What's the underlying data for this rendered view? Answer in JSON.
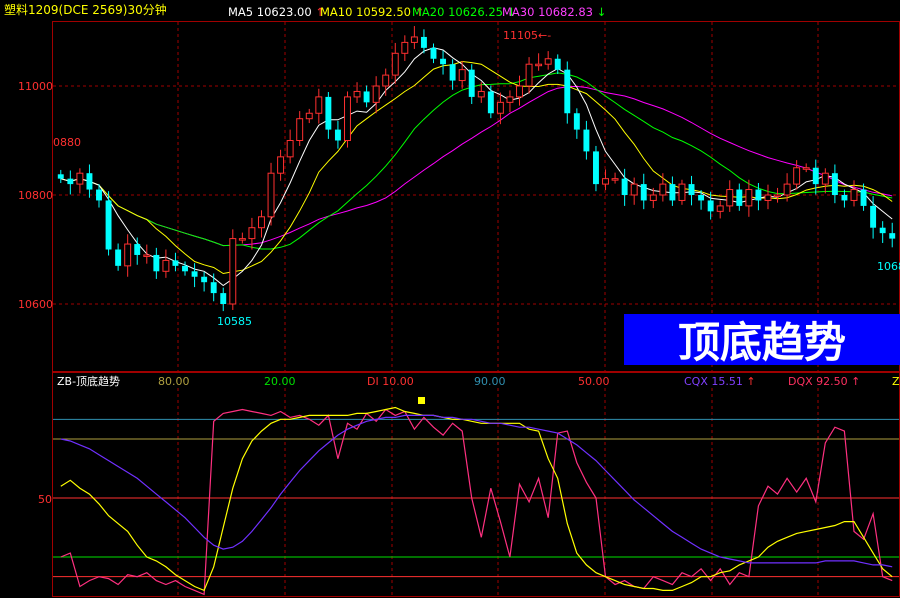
{
  "header": {
    "instrument": "塑料1209(DCE 2569)30分钟",
    "ma": [
      {
        "label": "MA5",
        "value": "10623.00",
        "arrow": "↑",
        "color": "#ffffff"
      },
      {
        "label": "MA10",
        "value": "10592.50",
        "arrow": "↑",
        "color": "#ffff00"
      },
      {
        "label": "MA20",
        "value": "10626.25",
        "arrow": "↓",
        "color": "#00ff00"
      },
      {
        "label": "MA30",
        "value": "10682.83",
        "arrow": "↓",
        "color": "#ff00ff"
      }
    ]
  },
  "price_axis": {
    "ticks": [
      "11000",
      "10800",
      "10600"
    ]
  },
  "annotations": {
    "left_high": "0880",
    "peak": "11105",
    "low": "10585",
    "right_edge": "1068"
  },
  "banner": {
    "text": "顶底趋势"
  },
  "indicator": {
    "name": "ZB-顶底趋势",
    "params": [
      {
        "label": "",
        "value": "80.00",
        "color": "#b0a040"
      },
      {
        "label": "",
        "value": "20.00",
        "color": "#00e000"
      },
      {
        "label": "DI",
        "value": "10.00",
        "color": "#ff3030"
      },
      {
        "label": "",
        "value": "90.00",
        "color": "#3090b0"
      },
      {
        "label": "",
        "value": "50.00",
        "color": "#ff3030"
      },
      {
        "label": "CQX",
        "value": "15.51",
        "arrow": "↑",
        "color": "#8040ff"
      },
      {
        "label": "DQX",
        "value": "92.50",
        "arrow": "↑",
        "color": "#ff3060"
      },
      {
        "label": "Z",
        "value": "",
        "color": "#ffff00"
      }
    ],
    "axis_label": "50"
  },
  "colors": {
    "up": "#ff3030",
    "down": "#00ffff",
    "grid": "#a00000",
    "ma5": "#ffffff",
    "ma10": "#ffff00",
    "ma20": "#00ff00",
    "ma30": "#ff00ff",
    "banner_bg": "#0000ff"
  },
  "chart_data": [
    {
      "type": "candlestick",
      "title": "塑料1209(DCE 2569)30分钟",
      "ylim": [
        10500,
        11120
      ],
      "close": [
        10830,
        10820,
        10840,
        10810,
        10790,
        10700,
        10670,
        10710,
        10690,
        10690,
        10660,
        10680,
        10670,
        10660,
        10650,
        10640,
        10620,
        10600,
        10720,
        10720,
        10740,
        10760,
        10840,
        10870,
        10900,
        10940,
        10950,
        10980,
        10920,
        10900,
        10980,
        10990,
        10970,
        11000,
        11020,
        11060,
        11080,
        11090,
        11070,
        11050,
        11040,
        11010,
        11030,
        10980,
        10990,
        10950,
        10970,
        10980,
        11000,
        11040,
        11040,
        11050,
        11030,
        10950,
        10920,
        10880,
        10820,
        10830,
        10830,
        10800,
        10820,
        10790,
        10800,
        10820,
        10790,
        10820,
        10800,
        10790,
        10770,
        10780,
        10810,
        10780,
        10810,
        10790,
        10800,
        10800,
        10820,
        10850,
        10850,
        10820,
        10840,
        10800,
        10790,
        10810,
        10780,
        10740,
        10730,
        10720
      ]
    },
    {
      "type": "line",
      "title": "ZB-顶底趋势",
      "ylim": [
        0,
        100
      ],
      "series": [
        {
          "name": "DI",
          "values": [
            20,
            22,
            5,
            8,
            10,
            9,
            6,
            11,
            10,
            12,
            8,
            6,
            8,
            5,
            3,
            1,
            89,
            93,
            94,
            95,
            94,
            93,
            92,
            94,
            91,
            92,
            90,
            87,
            92,
            70,
            88,
            85,
            93,
            89,
            95,
            92,
            94,
            85,
            91,
            86,
            82,
            88,
            84,
            50,
            30,
            55,
            38,
            20,
            57,
            48,
            60,
            40,
            83,
            84,
            68,
            58,
            50,
            10,
            6,
            8,
            5,
            4,
            10,
            8,
            6,
            12,
            10,
            14,
            8,
            14,
            6,
            12,
            10,
            46,
            56,
            52,
            60,
            53,
            60,
            48,
            78,
            86,
            84,
            33,
            29,
            42,
            10,
            8
          ]
        },
        {
          "name": "Z",
          "values": [
            56,
            59,
            55,
            52,
            47,
            41,
            37,
            33,
            26,
            20,
            18,
            15,
            11,
            8,
            5,
            3,
            15,
            35,
            55,
            70,
            79,
            84,
            88,
            90,
            90,
            91,
            92,
            92,
            92,
            92,
            92,
            93,
            93,
            94,
            95,
            96,
            94,
            93,
            92,
            92,
            91,
            90,
            90,
            89,
            88,
            88,
            88,
            88,
            88,
            85,
            84,
            70,
            60,
            37,
            22,
            16,
            12,
            10,
            8,
            6,
            5,
            4,
            4,
            3,
            3,
            5,
            7,
            10,
            10,
            12,
            13,
            16,
            18,
            20,
            25,
            28,
            30,
            32,
            33,
            34,
            35,
            36,
            38,
            38,
            30,
            22,
            14,
            10
          ]
        },
        {
          "name": "CQX",
          "values": [
            80,
            79,
            77,
            75,
            72,
            69,
            66,
            63,
            60,
            56,
            52,
            48,
            44,
            40,
            35,
            30,
            26,
            24,
            25,
            28,
            33,
            39,
            45,
            52,
            58,
            64,
            69,
            74,
            78,
            82,
            85,
            87,
            89,
            90,
            91,
            91,
            92,
            92,
            92,
            92,
            91,
            91,
            90,
            90,
            89,
            88,
            88,
            87,
            86,
            86,
            85,
            84,
            83,
            80,
            77,
            73,
            69,
            64,
            59,
            54,
            49,
            45,
            41,
            37,
            33,
            30,
            27,
            24,
            22,
            20,
            19,
            18,
            17,
            17,
            17,
            17,
            17,
            17,
            17,
            17,
            18,
            18,
            18,
            18,
            17,
            16,
            16,
            15
          ]
        }
      ],
      "levels": [
        80,
        20,
        10,
        90,
        50
      ]
    }
  ]
}
